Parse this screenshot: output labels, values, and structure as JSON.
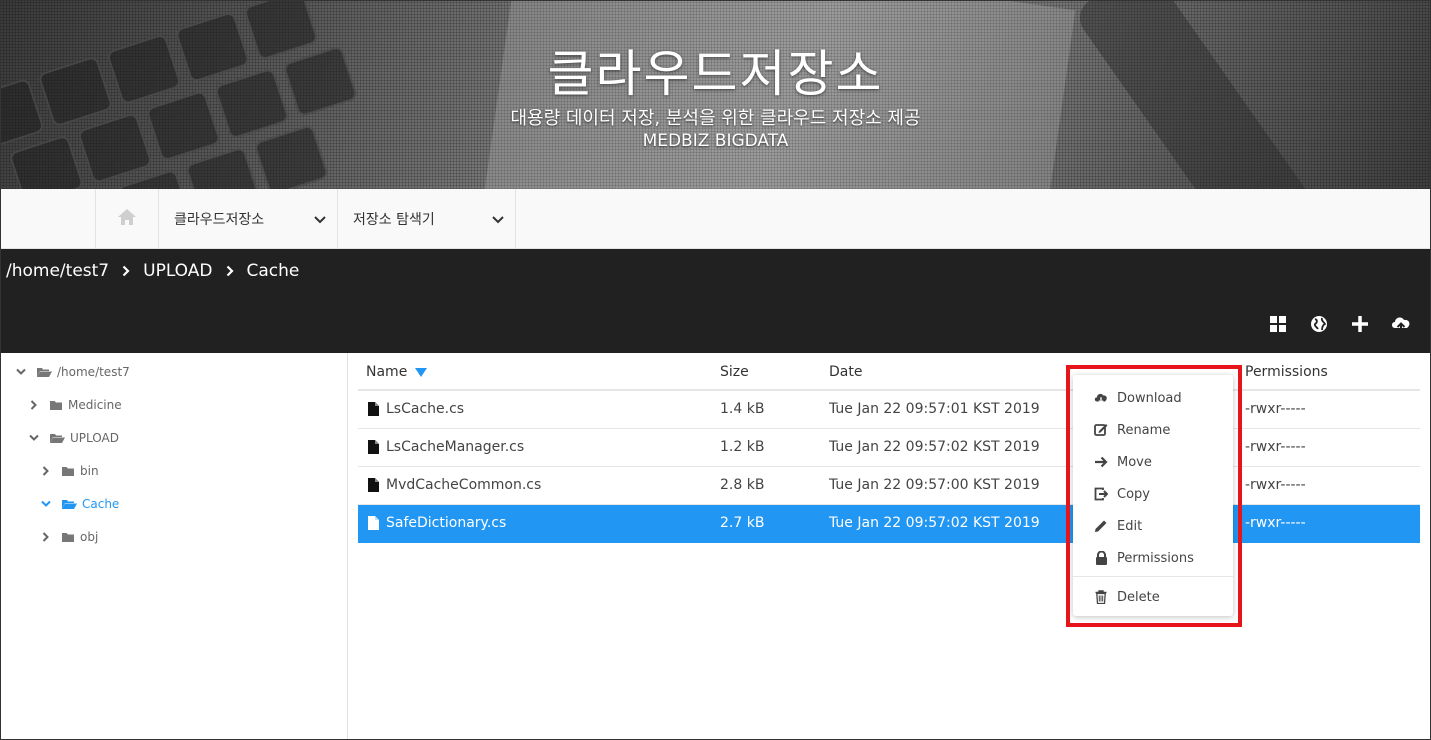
{
  "banner": {
    "title": "클라우드저장소",
    "subtitle": "대용량 데이터 저장, 분석을 위한 클라우드 저장소 제공",
    "brand": "MEDBIZ BIGDATA"
  },
  "nav": {
    "home_icon": "home-icon",
    "menu_cloud": "클라우드저장소",
    "menu_explorer": "저장소 탐색기"
  },
  "breadcrumb": [
    "/home/test7",
    "UPLOAD",
    "Cache"
  ],
  "toolbar": {
    "icons": [
      "grid-view-icon",
      "globe-icon",
      "plus-icon",
      "upload-cloud-icon"
    ]
  },
  "tree": [
    {
      "label": "/home/test7",
      "expanded": true,
      "level": 0
    },
    {
      "label": "Medicine",
      "expanded": false,
      "level": 1
    },
    {
      "label": "UPLOAD",
      "expanded": true,
      "level": 1
    },
    {
      "label": "bin",
      "expanded": false,
      "level": 2
    },
    {
      "label": "Cache",
      "expanded": true,
      "level": 2,
      "active": true
    },
    {
      "label": "obj",
      "expanded": false,
      "level": 2
    }
  ],
  "table": {
    "columns": {
      "name": "Name",
      "size": "Size",
      "date": "Date",
      "permissions": "Permissions"
    },
    "sort": {
      "column": "Name",
      "direction": "desc"
    },
    "rows": [
      {
        "name": "LsCache.cs",
        "size": "1.4 kB",
        "date": "Tue Jan 22 09:57:01 KST 2019",
        "permissions": "-rwxr-----"
      },
      {
        "name": "LsCacheManager.cs",
        "size": "1.2 kB",
        "date": "Tue Jan 22 09:57:02 KST 2019",
        "permissions": "-rwxr-----"
      },
      {
        "name": "MvdCacheCommon.cs",
        "size": "2.8 kB",
        "date": "Tue Jan 22 09:57:00 KST 2019",
        "permissions": "-rwxr-----"
      },
      {
        "name": "SafeDictionary.cs",
        "size": "2.7 kB",
        "date": "Tue Jan 22 09:57:02 KST 2019",
        "permissions": "-rwxr-----",
        "selected": true
      }
    ]
  },
  "context_menu": {
    "items": [
      {
        "label": "Download",
        "icon": "cloud-download-icon"
      },
      {
        "label": "Rename",
        "icon": "rename-icon"
      },
      {
        "label": "Move",
        "icon": "arrow-right-icon"
      },
      {
        "label": "Copy",
        "icon": "copy-icon"
      },
      {
        "label": "Edit",
        "icon": "pencil-icon"
      },
      {
        "label": "Permissions",
        "icon": "lock-icon"
      },
      {
        "label": "Delete",
        "icon": "trash-icon"
      }
    ]
  },
  "colors": {
    "accent": "#2196f3",
    "dark_bar": "#212121",
    "highlight_border": "#e6141b"
  }
}
